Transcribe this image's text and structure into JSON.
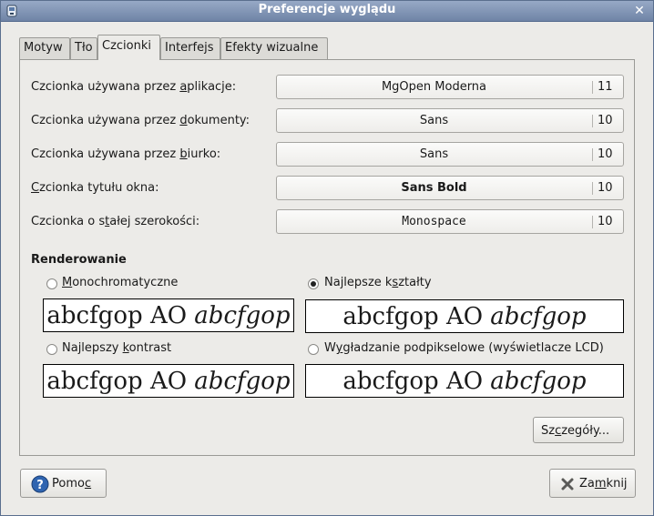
{
  "window": {
    "title": "Preferencje wyglądu",
    "close_glyph": "✕"
  },
  "tabs": [
    {
      "label": "Motyw"
    },
    {
      "label": "Tło"
    },
    {
      "label": "Czcionki",
      "active": true
    },
    {
      "label": "Interfejs"
    },
    {
      "label": "Efekty wizualne"
    }
  ],
  "fonts": {
    "application": {
      "pre": "Czcionka używana przez ",
      "mn": "a",
      "post": "plikacje:",
      "name": "MgOpen Moderna",
      "size": "11"
    },
    "document": {
      "pre": "Czcionka używana przez ",
      "mn": "d",
      "post": "okumenty:",
      "name": "Sans",
      "size": "10"
    },
    "desktop": {
      "pre": "Czcionka używana przez ",
      "mn": "b",
      "post": "iurko:",
      "name": "Sans",
      "size": "10"
    },
    "window_title": {
      "pre": "",
      "mn": "C",
      "post": "zcionka tytułu okna:",
      "name": "Sans Bold",
      "size": "10"
    },
    "fixed": {
      "pre": "Czcionka o s",
      "mn": "t",
      "post": "ałej szerokości:",
      "name": "Monospace",
      "size": "10"
    }
  },
  "rendering": {
    "title": "Renderowanie",
    "sample_text": "abcfgop AO ",
    "sample_italic": "abcfgop",
    "options": {
      "mono": {
        "pre": "",
        "mn": "M",
        "post": "onochromatyczne",
        "checked": false
      },
      "best_shapes": {
        "pre": "Najlepsze k",
        "mn": "s",
        "post": "ztałty",
        "checked": true
      },
      "best_contrast": {
        "pre": "Najlepszy ",
        "mn": "k",
        "post": "ontrast",
        "checked": false
      },
      "subpixel": {
        "pre": "W",
        "mn": "y",
        "post": "gładzanie podpikselowe (wyświetlacze LCD)",
        "checked": false
      }
    }
  },
  "buttons": {
    "details": {
      "pre": "Sz",
      "mn": "c",
      "post": "zegóły..."
    },
    "help": {
      "pre": "Pomo",
      "mn": "c",
      "post": ""
    },
    "close": {
      "pre": "Za",
      "mn": "m",
      "post": "knij"
    }
  },
  "colors": {
    "titlebar": "#7d91b1",
    "window_bg": "#ecebe8",
    "help_icon": "#2f64b0"
  }
}
